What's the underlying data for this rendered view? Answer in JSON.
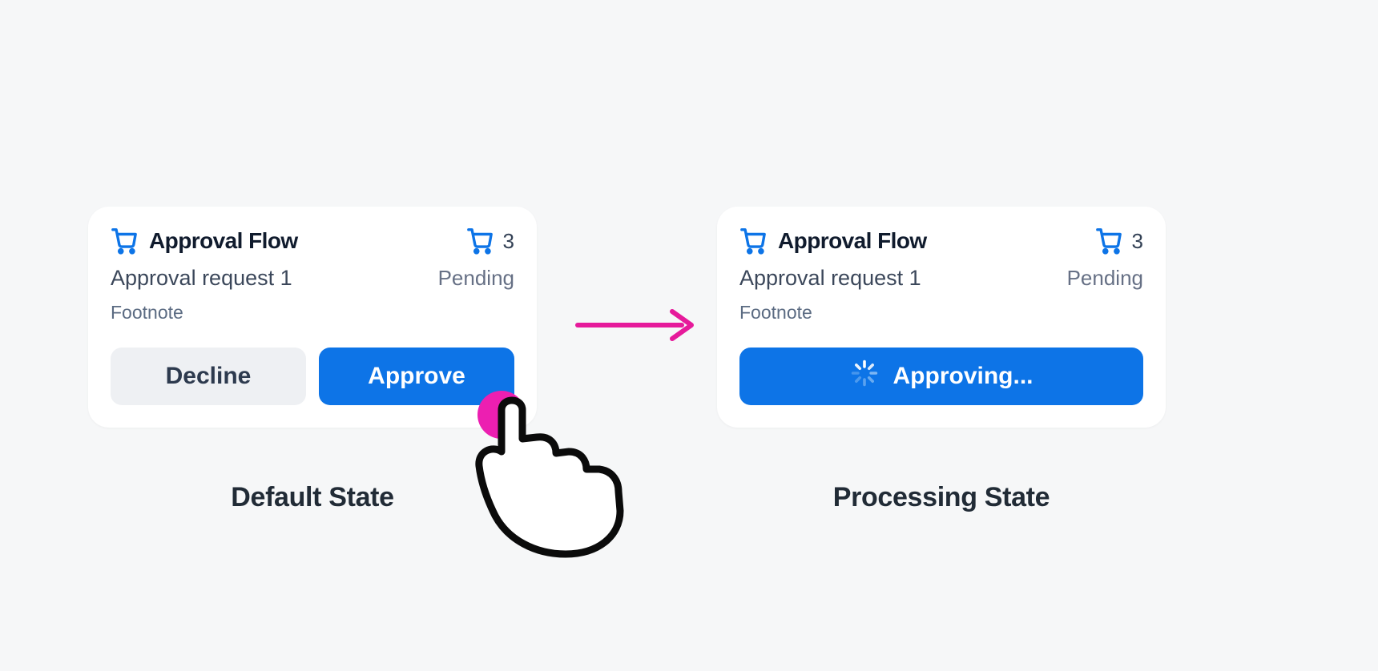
{
  "default_state": {
    "header_title": "Approval Flow",
    "cart_count": "3",
    "subtitle": "Approval request 1",
    "status": "Pending",
    "footnote": "Footnote",
    "decline_label": "Decline",
    "approve_label": "Approve",
    "caption": "Default State"
  },
  "processing_state": {
    "header_title": "Approval Flow",
    "cart_count": "3",
    "subtitle": "Approval request 1",
    "status": "Pending",
    "footnote": "Footnote",
    "processing_label": "Approving...",
    "caption": "Processing State"
  },
  "colors": {
    "primary": "#0d74e7",
    "secondary_bg": "#eef0f3",
    "arrow": "#e61a9b"
  }
}
